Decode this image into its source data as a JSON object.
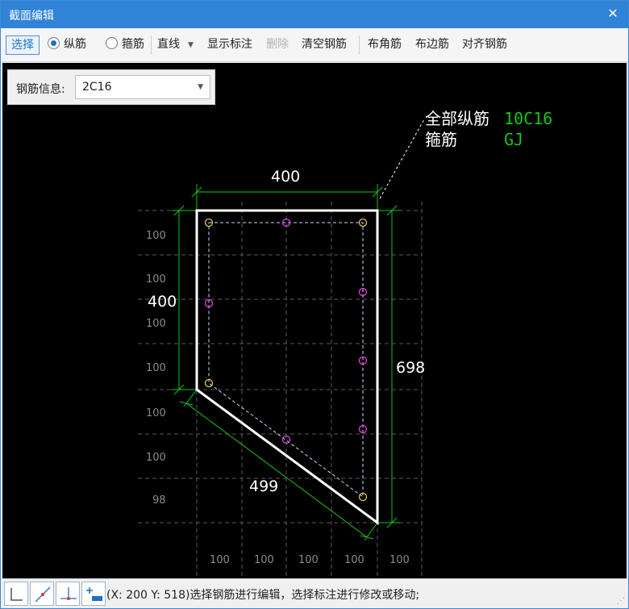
{
  "window": {
    "title": "截面编辑",
    "close_glyph": "✕"
  },
  "toolbar": {
    "select_label": "选择",
    "longitudinal_label": "纵筋",
    "stirrup_label": "箍筋",
    "line_type_value": "直线",
    "show_dimension_label": "显示标注",
    "delete_label": "删除",
    "clear_label": "清空钢筋",
    "corner_label": "布角筋",
    "edge_label": "布边筋",
    "align_label": "对齐钢筋"
  },
  "rebar_info": {
    "label": "钢筋信息:",
    "value": "2C16"
  },
  "drawing": {
    "annotation": {
      "longitudinal_label": "全部纵筋",
      "longitudinal_value": "10C16",
      "stirrup_label": "箍筋",
      "stirrup_value": "GJ"
    },
    "dimensions": {
      "top": "400",
      "left": "400",
      "right": "698",
      "slant": "499"
    },
    "grid_labels_left": [
      "100",
      "100",
      "100",
      "100",
      "100",
      "100",
      "98"
    ],
    "grid_labels_bottom": [
      "100",
      "100",
      "100",
      "100",
      "100"
    ],
    "colors": {
      "background": "#000000",
      "outline": "#ffffff",
      "dimension": "#19c419",
      "corner_rebar": "#e8c24a",
      "edge_rebar": "#e040e0",
      "stirrup_dash": "#c8d8ff",
      "annotation_value": "#19c419"
    }
  },
  "statusbar": {
    "text": "(X: 200 Y: 518)选择钢筋进行编辑，选择标注进行修改或移动;",
    "icons": [
      "ortho-axis-icon",
      "snap-point-icon",
      "perpendicular-icon",
      "add-dimension-icon"
    ]
  }
}
